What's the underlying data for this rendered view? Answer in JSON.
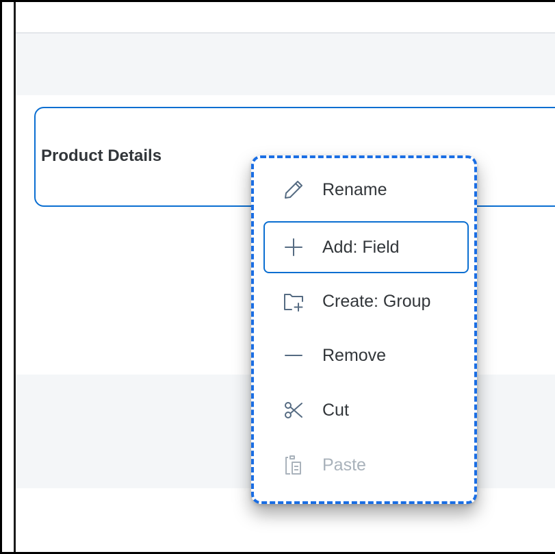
{
  "group": {
    "title": "Product Details"
  },
  "context_menu": {
    "items": [
      {
        "label": "Rename",
        "icon": "pencil-icon",
        "enabled": true
      },
      {
        "label": "Add: Field",
        "icon": "plus-icon",
        "enabled": true,
        "focused": true
      },
      {
        "label": "Create: Group",
        "icon": "folder-add-icon",
        "enabled": true
      },
      {
        "label": "Remove",
        "icon": "minus-icon",
        "enabled": true
      },
      {
        "label": "Cut",
        "icon": "scissors-icon",
        "enabled": true
      },
      {
        "label": "Paste",
        "icon": "clipboard-icon",
        "enabled": false
      }
    ]
  },
  "colors": {
    "accent": "#0a6ed1",
    "menu_border": "#1a6ee4",
    "text": "#32363a",
    "icon": "#556b82",
    "disabled": "#a9b2bb",
    "band_background": "#f4f6f8"
  }
}
